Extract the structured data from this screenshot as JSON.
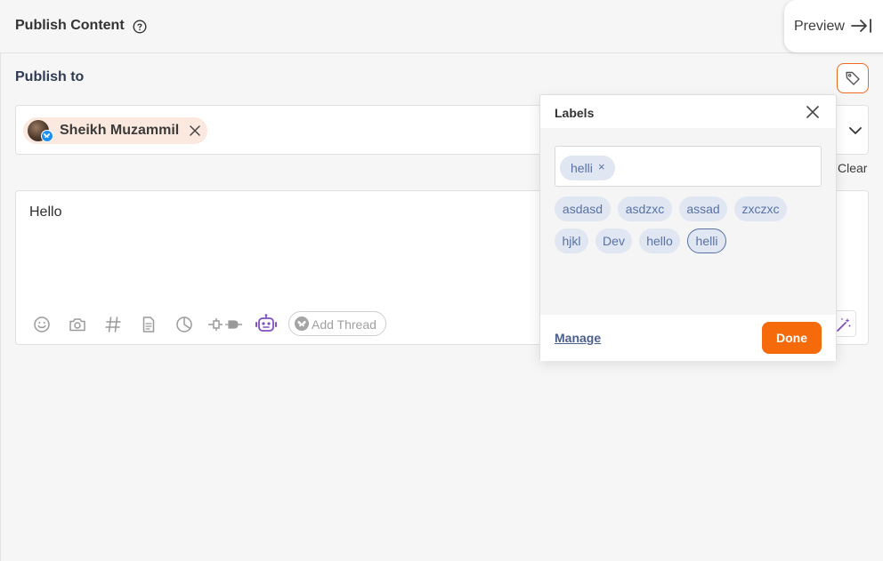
{
  "header": {
    "title": "Publish Content",
    "preview_label": "Preview"
  },
  "publish_to": {
    "label": "Publish to",
    "account": {
      "name": "Sheikh Muzammil",
      "platform": "bluesky"
    },
    "clear_label": "Clear"
  },
  "editor": {
    "text": "Hello",
    "add_thread_label": "Add Thread",
    "toolbar_icons": [
      "emoji-icon",
      "camera-icon",
      "hashtag-icon",
      "document-icon",
      "poll-icon",
      "connect-plug-icon",
      "ai-bot-icon"
    ]
  },
  "labels_popover": {
    "title": "Labels",
    "selected": [
      {
        "label": "helli"
      }
    ],
    "options": [
      {
        "label": "asdasd",
        "selected": false
      },
      {
        "label": "asdzxc",
        "selected": false
      },
      {
        "label": "assad",
        "selected": false
      },
      {
        "label": "zxczxc",
        "selected": false
      },
      {
        "label": "hjkl",
        "selected": false
      },
      {
        "label": "Dev",
        "selected": false
      },
      {
        "label": "hello",
        "selected": false
      },
      {
        "label": "helli",
        "selected": true
      }
    ],
    "manage_label": "Manage",
    "done_label": "Done"
  },
  "colors": {
    "accent": "#f56a0a",
    "label_chip_bg": "#e0e6f2",
    "label_chip_text": "#5872a4",
    "account_chip_bg": "#fbe9df"
  }
}
